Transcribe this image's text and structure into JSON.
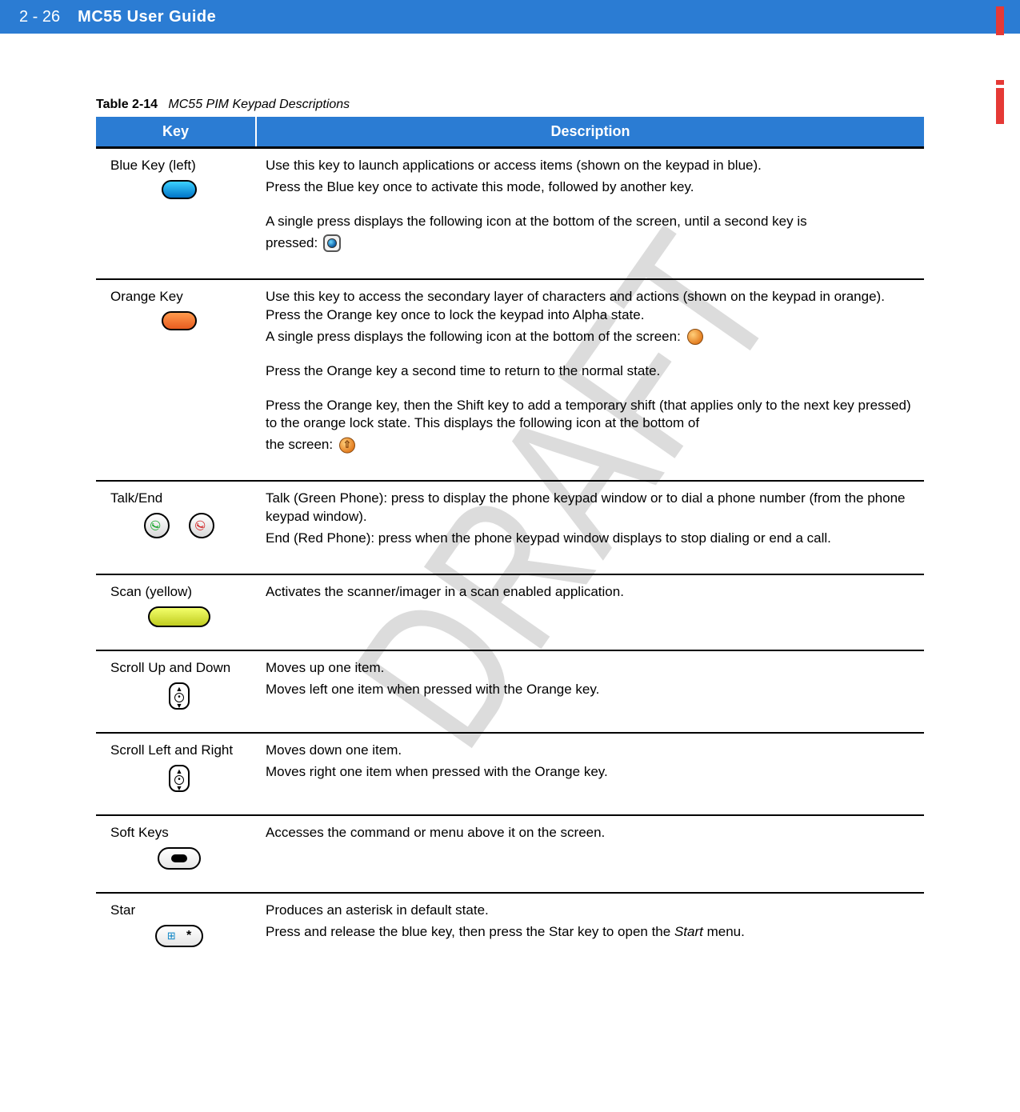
{
  "header": {
    "page_number": "2 - 26",
    "doc_title": "MC55 User Guide"
  },
  "watermark": "DRAFT",
  "caption": {
    "label": "Table 2-14",
    "title": "MC55 PIM Keypad Descriptions"
  },
  "columns": {
    "key": "Key",
    "description": "Description"
  },
  "rows": {
    "blue": {
      "name": "Blue Key (left)",
      "p1": "Use this key to launch applications or access items (shown on the keypad in blue).",
      "p2": "Press the Blue key once to activate this mode, followed by another key.",
      "p3a": "A single press displays the following icon at the bottom of the screen, until a second key is",
      "p3b": "pressed:"
    },
    "orange": {
      "name": "Orange Key",
      "p1": "Use this key to access the secondary layer of characters and actions (shown on the keypad in orange). Press the Orange key once to lock the keypad into Alpha state.",
      "p2": "A single press displays the following icon at the bottom of the screen:",
      "p3": "Press the Orange key a second time to return to the normal state.",
      "p4": "Press the Orange key, then the Shift key to add a temporary shift (that applies only to the next key pressed) to the orange lock state. This displays the following icon at the bottom of",
      "p4b": "the screen:"
    },
    "talkend": {
      "name": "Talk/End",
      "p1": "Talk (Green Phone): press to display the phone keypad window or to dial a phone number (from the phone keypad window).",
      "p2": "End (Red Phone): press when the phone keypad window displays to stop dialing or end a call."
    },
    "scan": {
      "name": "Scan (yellow)",
      "p1": "Activates the scanner/imager in a scan enabled application."
    },
    "scrollud": {
      "name": "Scroll Up and Down",
      "p1": "Moves up one item.",
      "p2": "Moves left one item when pressed with the Orange key."
    },
    "scrolllr": {
      "name": "Scroll Left and Right",
      "p1": "Moves down one item.",
      "p2": "Moves right one item when pressed with the Orange key."
    },
    "softkeys": {
      "name": "Soft Keys",
      "p1": "Accesses the command or menu above it on the screen."
    },
    "star": {
      "name": "Star",
      "p1": "Produces an asterisk in default state.",
      "p2a": "Press and release the blue key, then press the Star key to open the ",
      "p2b": "Start",
      "p2c": " menu."
    }
  }
}
